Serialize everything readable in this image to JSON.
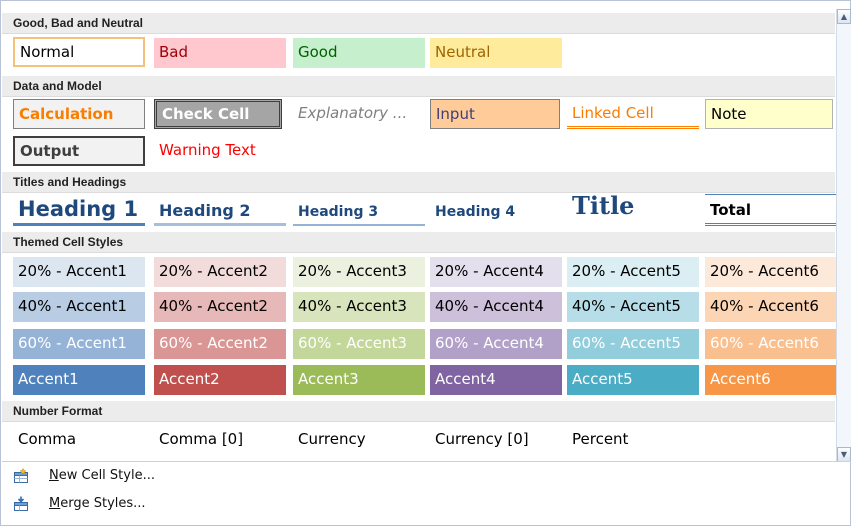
{
  "sections": {
    "good_bad_neutral": "Good, Bad and Neutral",
    "data_model": "Data and Model",
    "titles_headings": "Titles and Headings",
    "themed": "Themed Cell Styles",
    "number_format": "Number Format"
  },
  "styles": {
    "normal": "Normal",
    "bad": "Bad",
    "good": "Good",
    "neutral": "Neutral",
    "calculation": "Calculation",
    "check_cell": "Check Cell",
    "explanatory": "Explanatory ...",
    "input": "Input",
    "linked_cell": "Linked Cell",
    "note": "Note",
    "output": "Output",
    "warning_text": "Warning Text",
    "heading1": "Heading 1",
    "heading2": "Heading 2",
    "heading3": "Heading 3",
    "heading4": "Heading 4",
    "title": "Title",
    "total": "Total"
  },
  "themed": {
    "row20": [
      "20% - Accent1",
      "20% - Accent2",
      "20% - Accent3",
      "20% - Accent4",
      "20% - Accent5",
      "20% - Accent6"
    ],
    "row40": [
      "40% - Accent1",
      "40% - Accent2",
      "40% - Accent3",
      "40% - Accent4",
      "40% - Accent5",
      "40% - Accent6"
    ],
    "row60": [
      "60% - Accent1",
      "60% - Accent2",
      "60% - Accent3",
      "60% - Accent4",
      "60% - Accent5",
      "60% - Accent6"
    ],
    "accent": [
      "Accent1",
      "Accent2",
      "Accent3",
      "Accent4",
      "Accent5",
      "Accent6"
    ]
  },
  "number_format": [
    "Comma",
    "Comma [0]",
    "Currency",
    "Currency [0]",
    "Percent"
  ],
  "menu": {
    "new_style_prefix": "N",
    "new_style_rest": "ew Cell Style...",
    "merge_prefix": "M",
    "merge_rest": "erge Styles..."
  },
  "colors": {
    "accent1": "#4f81bd",
    "accent2": "#c0504d",
    "accent3": "#9bbb59",
    "accent4": "#8064a2",
    "accent5": "#4bacc6",
    "accent6": "#f79646"
  }
}
